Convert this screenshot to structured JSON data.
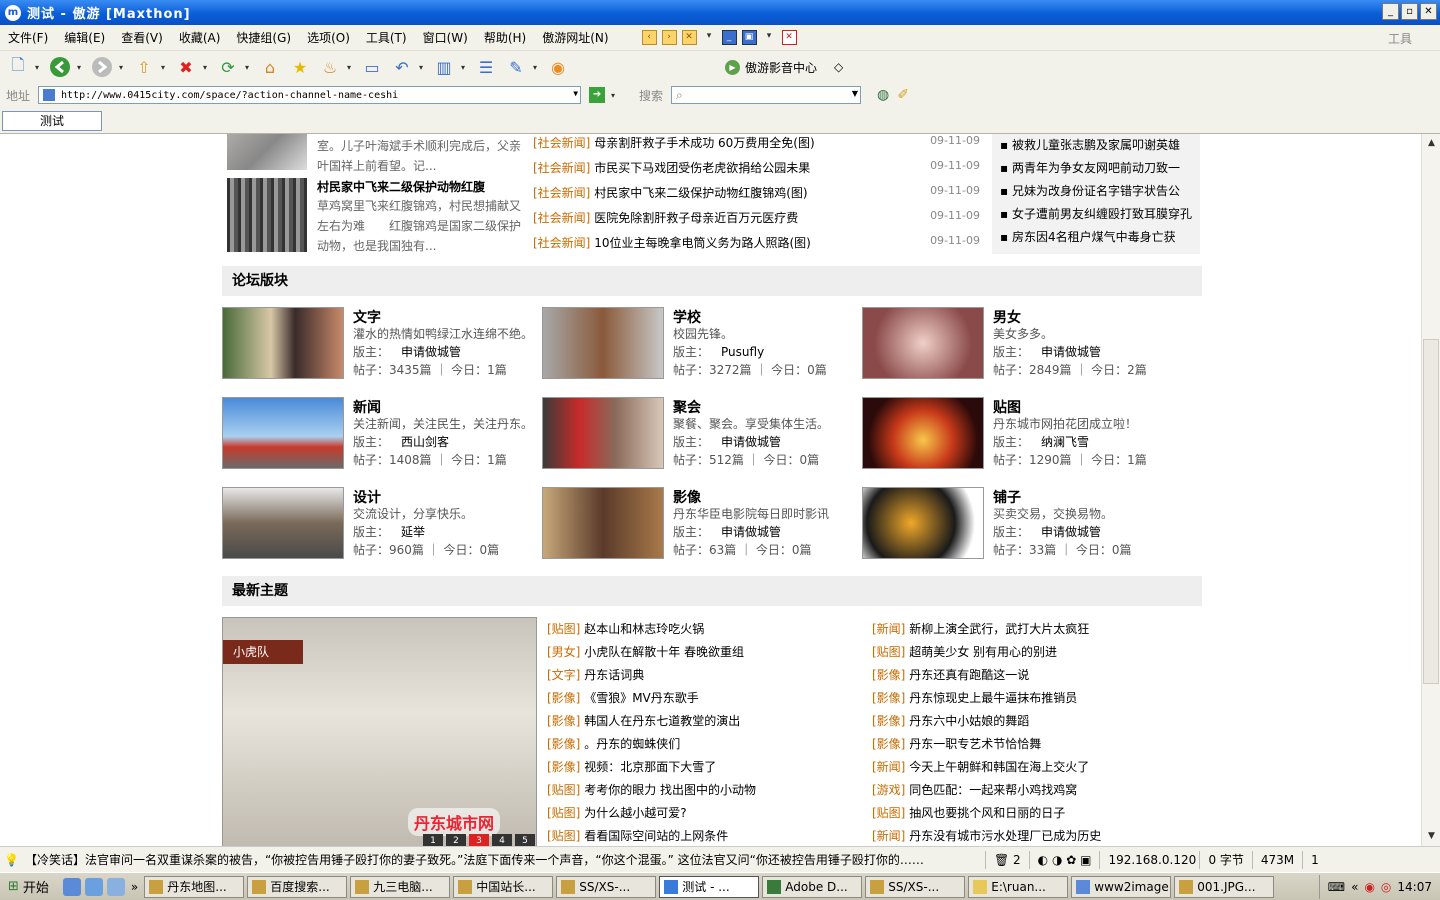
{
  "window": {
    "title": "测试 - 傲游 [Maxthon]"
  },
  "menu": {
    "items": [
      "文件(F)",
      "编辑(E)",
      "查看(V)",
      "收藏(A)",
      "快捷组(G)",
      "选项(O)",
      "工具(T)",
      "窗口(W)",
      "帮助(H)",
      "傲游网址(N)"
    ],
    "right_label": "工具"
  },
  "toolbar": {
    "media_center": "傲游影音中心"
  },
  "address": {
    "label": "地址",
    "url": "http://www.0415city.com/space/?action-channel-name-ceshi",
    "search_label": "搜索",
    "search_value": ""
  },
  "tabs": [
    {
      "label": "测试"
    }
  ],
  "hot": {
    "first_desc": "室。儿子叶海斌手术顺利完成后，父亲叶国祥上前看望。记...",
    "second_title": "村民家中飞来二级保护动物红腹",
    "second_desc": "草鸡窝里飞来红腹锦鸡，村民想捕献又左右为难　　红腹锦鸡是国家二级保护动物，也是我国独有..."
  },
  "news": [
    {
      "cat": "[社会新闻]",
      "title": "母亲割肝救子手术成功 60万费用全免(图)",
      "date": "09-11-09"
    },
    {
      "cat": "[社会新闻]",
      "title": "市民买下马戏团受伤老虎欲捐给公园未果",
      "date": "09-11-09"
    },
    {
      "cat": "[社会新闻]",
      "title": "村民家中飞来二级保护动物红腹锦鸡(图)",
      "date": "09-11-09"
    },
    {
      "cat": "[社会新闻]",
      "title": "医院免除割肝救子母亲近百万元医疗费",
      "date": "09-11-09"
    },
    {
      "cat": "[社会新闻]",
      "title": "10位业主每晚拿电筒义务为路人照路(图)",
      "date": "09-11-09"
    }
  ],
  "side": [
    "被救儿童张志鹏及家属叩谢英雄",
    "两青年为争女友网吧前动刀致一",
    "兄妹为改身份证名字错字状告公",
    "女子遭前男友纠缠殴打致耳膜穿孔",
    "房东因4名租户煤气中毒身亡获"
  ],
  "forum_section": {
    "title": "论坛版块"
  },
  "forums": [
    {
      "name": "文字",
      "desc": "灌水的热情如鸭绿江水连绵不绝。",
      "mod_label": "版主：",
      "mod": "申请做城管",
      "stat": "帖子：3435篇 ｜ 今日：1篇"
    },
    {
      "name": "学校",
      "desc": "校园先锋。",
      "mod_label": "版主：",
      "mod": "Pusufly",
      "stat": "帖子：3272篇 ｜ 今日：0篇"
    },
    {
      "name": "男女",
      "desc": "美女多多。",
      "mod_label": "版主：",
      "mod": "申请做城管",
      "stat": "帖子：2849篇 ｜ 今日：2篇"
    },
    {
      "name": "新闻",
      "desc": "关注新闻，关注民生，关注丹东。",
      "mod_label": "版主：",
      "mod": "西山剑客",
      "stat": "帖子：1408篇 ｜ 今日：1篇"
    },
    {
      "name": "聚会",
      "desc": "聚餐、聚会。享受集体生活。",
      "mod_label": "版主：",
      "mod": "申请做城管",
      "stat": "帖子：512篇 ｜ 今日：0篇"
    },
    {
      "name": "贴图",
      "desc": "丹东城市网拍花团成立啦！",
      "mod_label": "版主：",
      "mod": "纳澜飞雪",
      "stat": "帖子：1290篇 ｜ 今日：1篇"
    },
    {
      "name": "设计",
      "desc": "交流设计，分享快乐。",
      "mod_label": "版主：",
      "mod": "延举",
      "stat": "帖子：960篇 ｜ 今日：0篇"
    },
    {
      "name": "影像",
      "desc": "丹东华臣电影院每日即时影讯",
      "mod_label": "版主：",
      "mod": "申请做城管",
      "stat": "帖子：63篇 ｜ 今日：0篇"
    },
    {
      "name": "铺子",
      "desc": "买卖交易，交换易物。",
      "mod_label": "版主：",
      "mod": "申请做城管",
      "stat": "帖子：33篇 ｜ 今日：0篇"
    }
  ],
  "latest_section": {
    "title": "最新主题"
  },
  "photo": {
    "tag": "小虎队",
    "logo": "丹东城市网",
    "pages": [
      "1",
      "2",
      "3",
      "4",
      "5"
    ]
  },
  "topics_left": [
    {
      "cat": "[贴图]",
      "title": "赵本山和林志玲吃火锅"
    },
    {
      "cat": "[男女]",
      "title": "小虎队在解散十年 春晚欲重组"
    },
    {
      "cat": "[文字]",
      "title": "丹东话词典"
    },
    {
      "cat": "[影像]",
      "title": "《雪狼》MV丹东歌手"
    },
    {
      "cat": "[影像]",
      "title": "韩国人在丹东七道教堂的演出"
    },
    {
      "cat": "[影像]",
      "title": "。丹东的蜘蛛侠们"
    },
    {
      "cat": "[影像]",
      "title": "视频：北京那面下大雪了"
    },
    {
      "cat": "[贴图]",
      "title": "考考你的眼力 找出图中的小动物"
    },
    {
      "cat": "[贴图]",
      "title": "为什么越小越可爱?"
    },
    {
      "cat": "[贴图]",
      "title": "看看国际空间站的上网条件"
    }
  ],
  "topics_right": [
    {
      "cat": "[新闻]",
      "title": "新柳上演全武行，武打大片太疯狂"
    },
    {
      "cat": "[贴图]",
      "title": "超萌美少女 别有用心的别进"
    },
    {
      "cat": "[影像]",
      "title": "丹东还真有跑酷这一说"
    },
    {
      "cat": "[影像]",
      "title": "丹东惊现史上最牛逼抹布推销员"
    },
    {
      "cat": "[影像]",
      "title": "丹东六中小姑娘的舞蹈"
    },
    {
      "cat": "[影像]",
      "title": "丹东一职专艺术节恰恰舞"
    },
    {
      "cat": "[新闻]",
      "title": "今天上午朝鲜和韩国在海上交火了"
    },
    {
      "cat": "[游戏]",
      "title": "同色匹配：一起来帮小鸡找鸡窝"
    },
    {
      "cat": "[贴图]",
      "title": "抽风也要挑个风和日丽的日子"
    },
    {
      "cat": "[新闻]",
      "title": "丹东没有城市污水处理厂已成为历史"
    }
  ],
  "status": {
    "message": "【冷笑话】法官审问一名双重谋杀案的被告，“你被控告用锤子殴打你的妻子致死。”法庭下面传来一个声音，“你这个混蛋。” 这位法官又问“你还被控告用锤子殴打你的……",
    "count": "2",
    "ip": "192.168.0.120",
    "bytes": "0 字节",
    "mem": "473M",
    "num": "1"
  },
  "taskbar": {
    "start": "开始",
    "tasks": [
      {
        "label": "丹东地图..."
      },
      {
        "label": "百度搜索..."
      },
      {
        "label": "九三电脑..."
      },
      {
        "label": "中国站长..."
      },
      {
        "label": "SS/XS-..."
      },
      {
        "label": "测试 - ..."
      },
      {
        "label": "Adobe D..."
      },
      {
        "label": "SS/XS-..."
      },
      {
        "label": "E:\\ruan..."
      },
      {
        "label": "www2image"
      },
      {
        "label": "001.JPG..."
      }
    ],
    "clock": "14:07"
  }
}
